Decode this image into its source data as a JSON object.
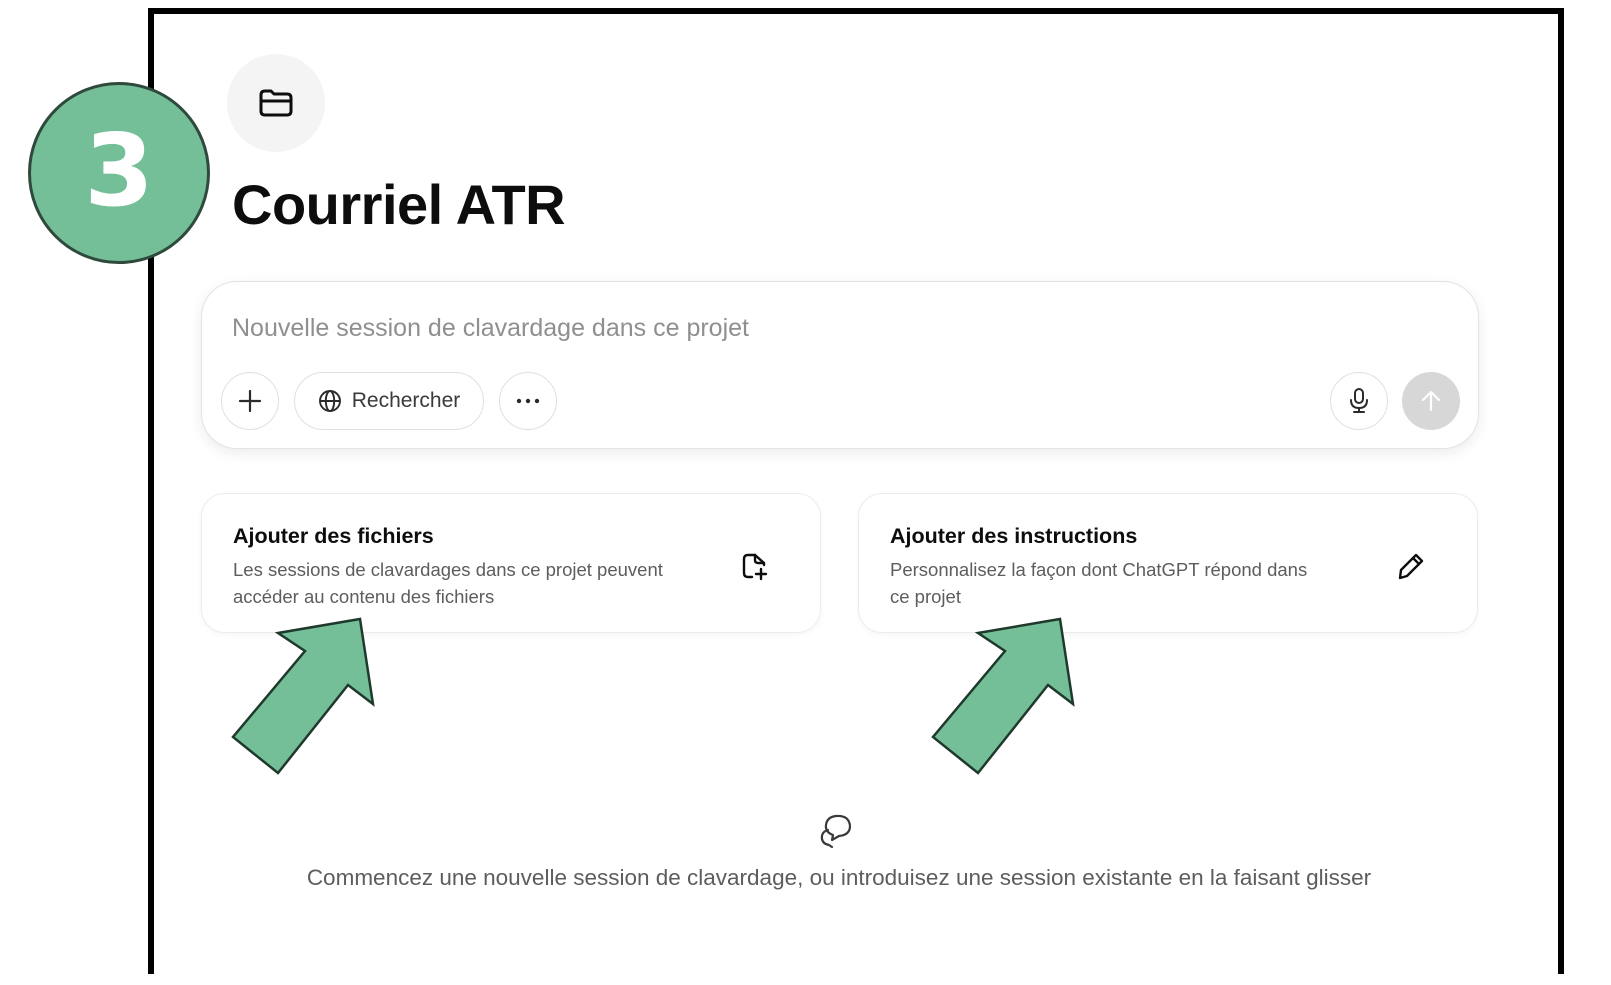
{
  "project": {
    "title": "Courriel ATR",
    "folder_icon": "folder-icon"
  },
  "composer": {
    "placeholder": "Nouvelle session de clavardage dans ce projet",
    "value": "",
    "buttons": {
      "add_icon": "plus-icon",
      "search_label": "Rechercher",
      "search_icon": "globe-icon",
      "more_icon": "ellipsis-icon",
      "mic_icon": "microphone-icon",
      "send_icon": "arrow-up-icon"
    }
  },
  "cards": [
    {
      "title": "Ajouter des fichiers",
      "description": "Les sessions de clavardages dans ce projet peuvent accéder au contenu des fichiers",
      "icon": "add-file-icon"
    },
    {
      "title": "Ajouter des instructions",
      "description": "Personnalisez la façon dont ChatGPT répond dans ce projet",
      "icon": "pencil-icon"
    }
  ],
  "empty_state": {
    "icon": "chat-bubbles-icon",
    "text": "Commencez une nouvelle session de clavardage, ou introduisez une session existante en la faisant glisser"
  },
  "annotation": {
    "step_number": "3",
    "marker_color": "#74bf98",
    "arrow_color": "#74bf98"
  },
  "colors": {
    "send_button_disabled": "#d7d7d7",
    "frame_border": "#000000"
  }
}
